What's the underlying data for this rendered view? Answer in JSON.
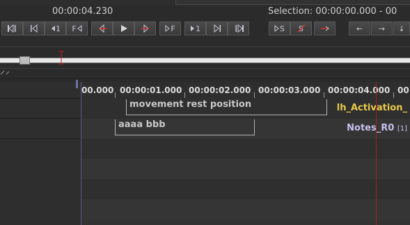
{
  "header": {
    "current_time": "00:00:04.230",
    "selection_text": "Selection: 00:00:00.000  -  00"
  },
  "transport": {
    "buttons": [
      {
        "name": "go-to-begin-button",
        "label": ""
      },
      {
        "name": "previous-scroll-view-button",
        "label": ""
      },
      {
        "name": "previous-pixel-button",
        "label": "1"
      },
      {
        "name": "previous-frame-button",
        "label": "F"
      },
      {
        "name": "previous-annotation-button",
        "label": ""
      },
      {
        "name": "play-pause-button",
        "label": ""
      },
      {
        "name": "next-annotation-button",
        "label": ""
      },
      {
        "name": "next-frame-button",
        "label": "F"
      },
      {
        "name": "next-pixel-button",
        "label": "1"
      },
      {
        "name": "next-scroll-view-button",
        "label": ""
      },
      {
        "name": "go-to-end-button",
        "label": ""
      }
    ],
    "selection_buttons": [
      {
        "name": "play-selection-button",
        "label": "S"
      },
      {
        "name": "clear-selection-button",
        "label": "S"
      },
      {
        "name": "selection-mode-button",
        "label": ""
      }
    ],
    "nav_buttons": [
      {
        "name": "left-arrow-button",
        "label": "←"
      },
      {
        "name": "right-arrow-button",
        "label": "→"
      },
      {
        "name": "down-arrow-button",
        "label": "↓"
      }
    ]
  },
  "ruler": {
    "ticks": [
      "00.000",
      "00:00:01.000",
      "00:00:02.000",
      "00:00:03.000",
      "00:00:04.000",
      "00:0"
    ]
  },
  "tiers": [
    {
      "name": "lh_Activation_",
      "count": "",
      "color": "#e8c94a"
    },
    {
      "name": "Notes_R0",
      "count": "[1]",
      "color": "#c9c0f0"
    }
  ],
  "annotations": [
    {
      "tier": "lh_Activation_",
      "text": "movement rest position"
    },
    {
      "tier": "Notes_R0",
      "text": "aaaa bbb"
    }
  ],
  "colors": {
    "cursor": "#b01c1c",
    "background": "#2b2b2b"
  }
}
